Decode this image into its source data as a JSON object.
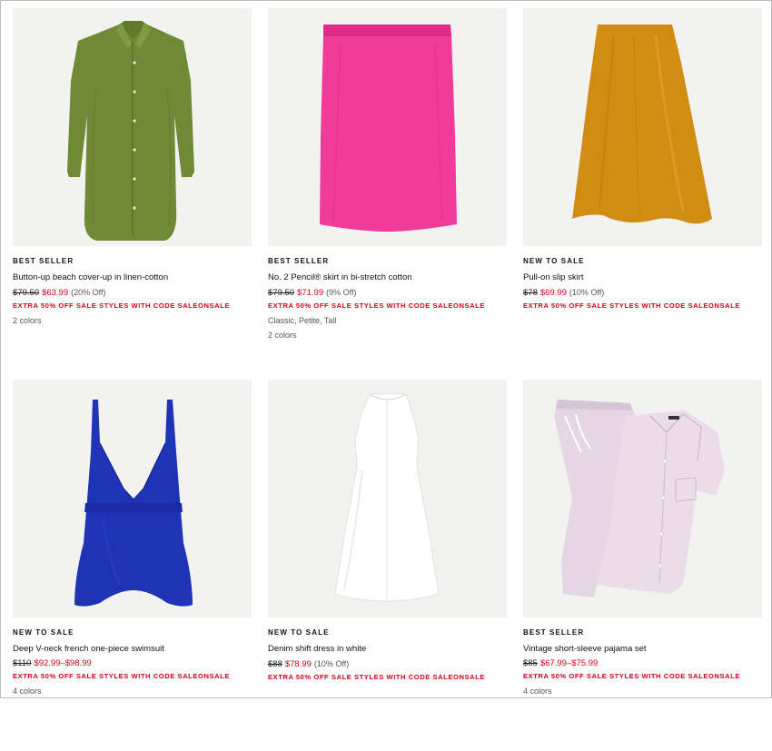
{
  "colors": {
    "sale_red": "#d0021b",
    "image_bg": "#f2f2f1"
  },
  "products": [
    {
      "badge": "BEST SELLER",
      "name": "Button-up beach cover-up in linen-cotton",
      "original_price": "$79.50",
      "sale_price": "$63.99",
      "discount": "(20% Off)",
      "promo": "EXTRA 50% OFF SALE STYLES WITH CODE SALEONSALE",
      "sizes": "",
      "colors_text": "2 colors",
      "image": "olive-green-shirt-dress"
    },
    {
      "badge": "BEST SELLER",
      "name": "No. 2 Pencil® skirt in bi-stretch cotton",
      "original_price": "$79.50",
      "sale_price": "$71.99",
      "discount": "(9% Off)",
      "promo": "EXTRA 50% OFF SALE STYLES WITH CODE SALEONSALE",
      "sizes": "Classic, Petite, Tall",
      "colors_text": "2 colors",
      "image": "pink-pencil-skirt"
    },
    {
      "badge": "NEW TO SALE",
      "name": "Pull-on slip skirt",
      "original_price": "$78",
      "sale_price": "$69.99",
      "discount": "(10% Off)",
      "promo": "EXTRA 50% OFF SALE STYLES WITH CODE SALEONSALE",
      "sizes": "",
      "colors_text": "",
      "image": "mustard-slip-skirt"
    },
    {
      "badge": "NEW TO SALE",
      "name": "Deep V-neck french one-piece swimsuit",
      "original_price": "$110",
      "sale_price": "$92.99–$98.99",
      "discount": "",
      "promo": "EXTRA 50% OFF SALE STYLES WITH CODE SALEONSALE",
      "sizes": "",
      "colors_text": "4 colors",
      "image": "blue-swimsuit"
    },
    {
      "badge": "NEW TO SALE",
      "name": "Denim shift dress in white",
      "original_price": "$88",
      "sale_price": "$78.99",
      "discount": "(10% Off)",
      "promo": "EXTRA 50% OFF SALE STYLES WITH CODE SALEONSALE",
      "sizes": "",
      "colors_text": "",
      "image": "white-shift-dress"
    },
    {
      "badge": "BEST SELLER",
      "name": "Vintage short-sleeve pajama set",
      "original_price": "$85",
      "sale_price": "$67.99–$75.99",
      "discount": "",
      "promo": "EXTRA 50% OFF SALE STYLES WITH CODE SALEONSALE",
      "sizes": "",
      "colors_text": "4 colors",
      "image": "lavender-pajama-set"
    }
  ]
}
